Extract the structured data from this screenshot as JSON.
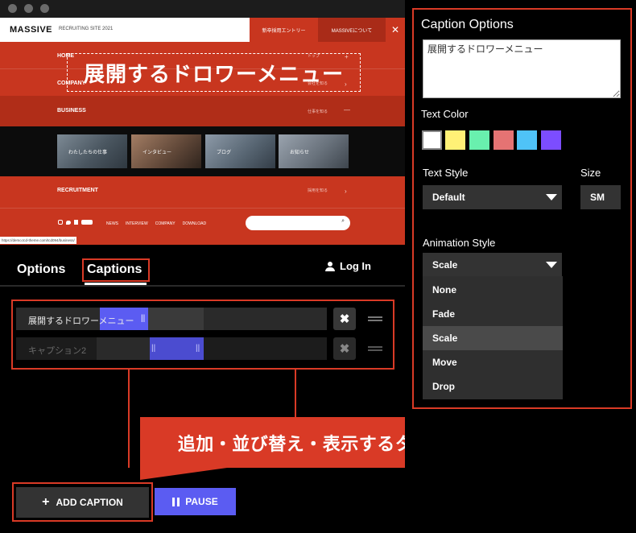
{
  "preview": {
    "brand": "MASSIVE",
    "brand_sub": "RECRUITING SITE 2021",
    "entry": "新卒採用エントリー",
    "about": "MASSIVEについて",
    "close": "✕",
    "menu": [
      {
        "label": "HOME",
        "sub": "トップ",
        "ind": "+"
      },
      {
        "label": "COMPANY",
        "sub": "会社を知る",
        "ind": "›"
      },
      {
        "label": "BUSINESS",
        "sub": "仕事を知る",
        "ind": "—"
      },
      {
        "label": "RECRUITMENT",
        "sub": "採用を知る",
        "ind": "›"
      }
    ],
    "thumbs": [
      "わたしたちの仕事",
      "インタビュー",
      "ブログ",
      "お知らせ"
    ],
    "footer_links": [
      "NEWS",
      "INTERVIEW",
      "COMPANY",
      "DOWNLOAD"
    ],
    "overlay_caption": "展開するドロワーメニュー",
    "status_url": "https://demo.tcd-theme.com/tcd094/business/"
  },
  "tabs": {
    "options": "Options",
    "captions": "Captions",
    "login": "Log In"
  },
  "captions": [
    {
      "text": "展開するドロワーメニュー",
      "active": true
    },
    {
      "text": "キャプション2",
      "active": false
    }
  ],
  "callout": "追加・並び替え・表示するタイミングの変更が可能",
  "buttons": {
    "add": "ADD CAPTION",
    "pause": "PAUSE"
  },
  "panel": {
    "title": "Caption Options",
    "textarea_value": "展開するドロワーメニュー",
    "text_color_label": "Text Color",
    "colors": [
      "#ffffff",
      "#fff176",
      "#69f0ae",
      "#e57373",
      "#4fc3f7",
      "#7c4dff"
    ],
    "text_style_label": "Text Style",
    "text_style_value": "Default",
    "size_label": "Size",
    "size_value": "SM",
    "animation_label": "Animation Style",
    "animation_value": "Scale",
    "animation_options": [
      "None",
      "Fade",
      "Scale",
      "Move",
      "Drop"
    ],
    "animation_highlighted": "Scale"
  }
}
